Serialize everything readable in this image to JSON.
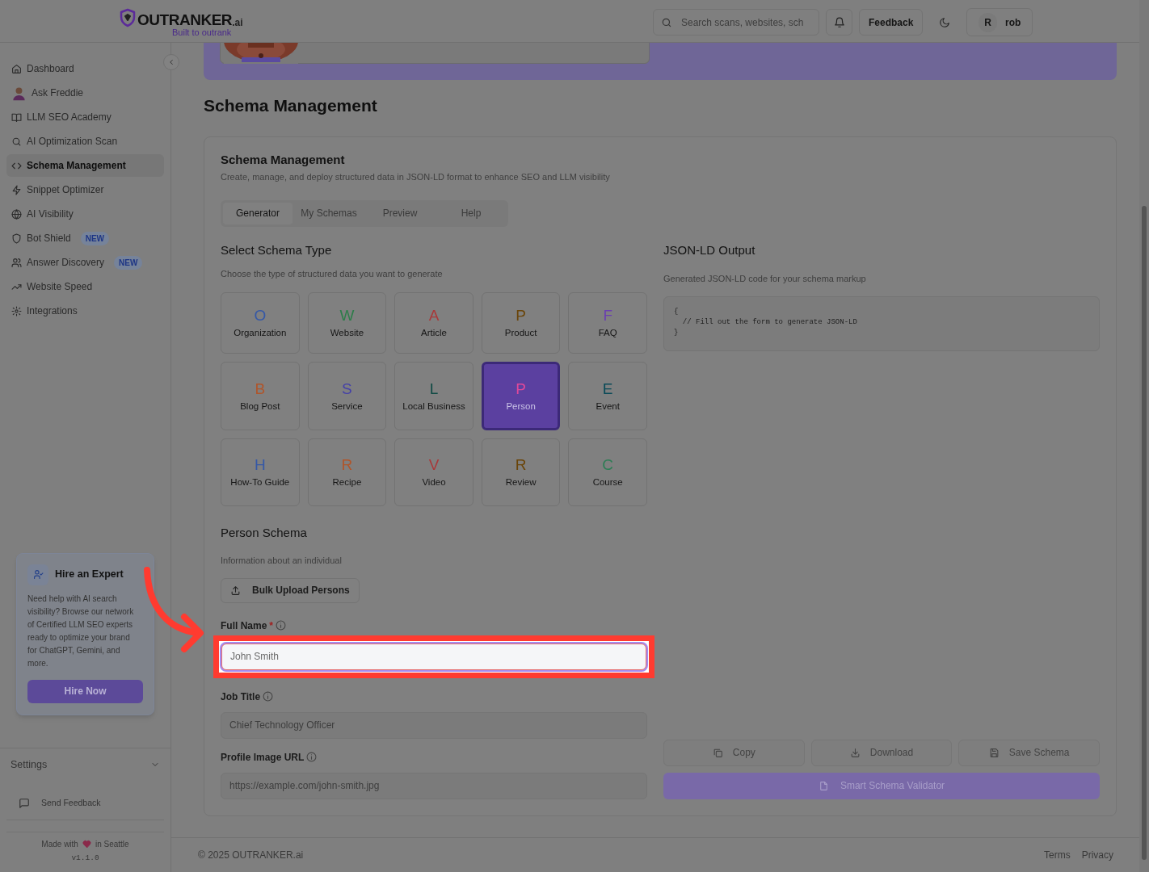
{
  "header": {
    "logo_text": "OUTRANKER",
    "logo_suffix": ".ai",
    "tagline": "Built to outrank",
    "search": {
      "placeholder": "Search scans, websites, sch"
    },
    "feedback_button": "Feedback",
    "user": {
      "initial": "R",
      "name": "rob"
    }
  },
  "sidebar": {
    "items": [
      {
        "label": "Dashboard",
        "kind": "icon",
        "selected": false
      },
      {
        "label": "Ask Freddie",
        "kind": "avatar",
        "selected": false
      },
      {
        "label": "LLM SEO Academy",
        "kind": "icon",
        "selected": false
      },
      {
        "label": "AI Optimization Scan",
        "kind": "icon",
        "selected": false
      },
      {
        "label": "Schema Management",
        "kind": "icon",
        "selected": true
      },
      {
        "label": "Snippet Optimizer",
        "kind": "icon",
        "selected": false
      },
      {
        "label": "AI Visibility",
        "kind": "icon",
        "selected": false
      },
      {
        "label": "Bot Shield",
        "kind": "icon",
        "selected": false,
        "badge": "NEW"
      },
      {
        "label": "Answer Discovery",
        "kind": "icon",
        "selected": false,
        "badge": "NEW"
      },
      {
        "label": "Website Speed",
        "kind": "icon",
        "selected": false
      },
      {
        "label": "Integrations",
        "kind": "icon",
        "selected": false
      }
    ],
    "expert_card": {
      "title": "Hire an Expert",
      "text": "Need help with AI search visibility? Browse our network of Certified LLM SEO experts ready to optimize your brand for ChatGPT, Gemini, and more.",
      "button": "Hire Now"
    },
    "settings": {
      "label": "Settings",
      "expanded": false
    },
    "send_feedback": "Send Feedback",
    "credit": {
      "before": "Made with",
      "after": "in Seattle",
      "version": "v1.1.0"
    }
  },
  "page_title": "Schema Management",
  "panel": {
    "title": "Schema Management",
    "subtitle": "Create, manage, and deploy structured data in JSON-LD format to enhance SEO and LLM visibility",
    "tabs": [
      {
        "label": "Generator",
        "selected": true
      },
      {
        "label": "My Schemas",
        "selected": false
      },
      {
        "label": "Preview",
        "selected": false
      },
      {
        "label": "Help",
        "selected": false
      }
    ],
    "type_section": {
      "title": "Select Schema Type",
      "subtitle": "Choose the type of structured data you want to generate"
    },
    "schema_types": [
      {
        "letter": "O",
        "label": "Organization",
        "color": "#3558a6",
        "selected": false
      },
      {
        "letter": "W",
        "label": "Website",
        "color": "#2e7d4a",
        "selected": false
      },
      {
        "letter": "A",
        "label": "Article",
        "color": "#a8393a",
        "selected": false
      },
      {
        "letter": "P",
        "label": "Product",
        "color": "#6a4408",
        "selected": false
      },
      {
        "letter": "F",
        "label": "FAQ",
        "color": "#6a3fb0",
        "selected": false
      },
      {
        "letter": "B",
        "label": "Blog Post",
        "color": "#b0552a",
        "selected": false
      },
      {
        "letter": "S",
        "label": "Service",
        "color": "#4440a8",
        "selected": false
      },
      {
        "letter": "L",
        "label": "Local Business",
        "color": "#0f4a44",
        "selected": false
      },
      {
        "letter": "P",
        "label": "Person",
        "color": "#e0489a",
        "selected": true
      },
      {
        "letter": "E",
        "label": "Event",
        "color": "#0a4a58",
        "selected": false
      },
      {
        "letter": "H",
        "label": "How-To Guide",
        "color": "#3558a6",
        "selected": false
      },
      {
        "letter": "R",
        "label": "Recipe",
        "color": "#b0552a",
        "selected": false
      },
      {
        "letter": "V",
        "label": "Video",
        "color": "#a8393a",
        "selected": false
      },
      {
        "letter": "R",
        "label": "Review",
        "color": "#6a4408",
        "selected": false
      },
      {
        "letter": "C",
        "label": "Course",
        "color": "#2e7d55",
        "selected": false
      }
    ],
    "form": {
      "title": "Person Schema",
      "subtitle": "Information about an individual",
      "bulk_button": "Bulk Upload Persons",
      "fields": [
        {
          "label": "Full Name",
          "required_mark": "*",
          "placeholder": "John Smith",
          "highlighted": true
        },
        {
          "label": "Job Title",
          "placeholder": "Chief Technology Officer",
          "highlighted": false
        },
        {
          "label": "Profile Image URL",
          "placeholder": "https://example.com/john-smith.jpg",
          "highlighted": false
        }
      ]
    },
    "output": {
      "title": "JSON-LD Output",
      "subtitle": "Generated JSON-LD code for your schema markup",
      "code_lines": [
        "{",
        "  // Fill out the form to generate JSON-LD",
        "}"
      ],
      "actions": [
        "Copy",
        "Download",
        "Save Schema"
      ],
      "validator_button": "Smart Schema Validator"
    }
  },
  "footer": {
    "copyright": "© 2025 OUTRANKER.ai",
    "links": [
      "Terms",
      "Privacy"
    ]
  }
}
